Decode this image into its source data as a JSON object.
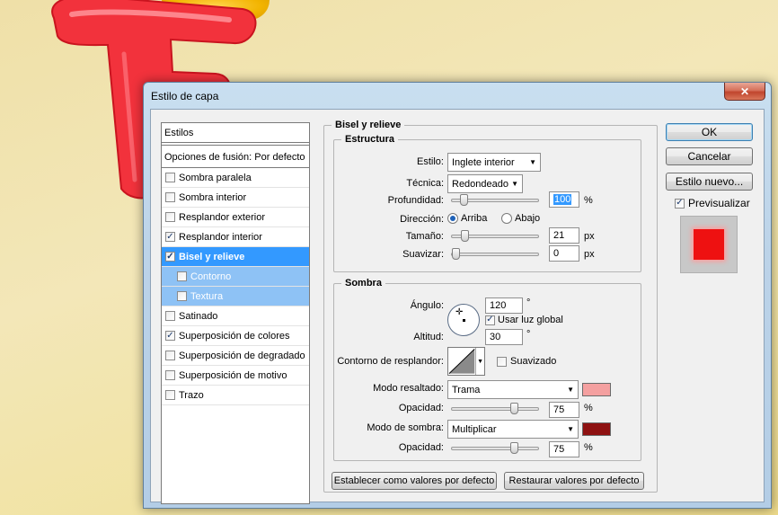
{
  "window": {
    "title": "Estilo de capa",
    "close_label": "✕"
  },
  "styles_panel": {
    "header": "Estilos",
    "blend_options": "Opciones de fusión: Por defecto",
    "items": [
      {
        "label": "Sombra paralela",
        "checked": false,
        "state": "normal"
      },
      {
        "label": "Sombra interior",
        "checked": false,
        "state": "normal"
      },
      {
        "label": "Resplandor exterior",
        "checked": false,
        "state": "normal"
      },
      {
        "label": "Resplandor interior",
        "checked": true,
        "state": "normal"
      },
      {
        "label": "Bisel y relieve",
        "checked": true,
        "state": "selected"
      },
      {
        "label": "Contorno",
        "checked": false,
        "state": "sub"
      },
      {
        "label": "Textura",
        "checked": false,
        "state": "sub"
      },
      {
        "label": "Satinado",
        "checked": false,
        "state": "normal"
      },
      {
        "label": "Superposición de colores",
        "checked": true,
        "state": "normal"
      },
      {
        "label": "Superposición de degradado",
        "checked": false,
        "state": "normal"
      },
      {
        "label": "Superposición de motivo",
        "checked": false,
        "state": "normal"
      },
      {
        "label": "Trazo",
        "checked": false,
        "state": "normal"
      }
    ]
  },
  "bevel": {
    "title": "Bisel y relieve",
    "structure": {
      "title": "Estructura",
      "style_label": "Estilo:",
      "style_value": "Inglete interior",
      "technique_label": "Técnica:",
      "technique_value": "Redondeado",
      "depth_label": "Profundidad:",
      "depth_value": "100",
      "depth_unit": "%",
      "depth_level": 0.1,
      "direction_label": "Dirección:",
      "direction_up": "Arriba",
      "direction_down": "Abajo",
      "direction_selected": "Arriba",
      "size_label": "Tamaño:",
      "size_value": "21",
      "size_unit": "px",
      "size_level": 0.12,
      "soften_label": "Suavizar:",
      "soften_value": "0",
      "soften_unit": "px",
      "soften_level": 0
    },
    "shading": {
      "title": "Sombra",
      "angle_label": "Ángulo:",
      "angle_value": "120",
      "angle_unit": "°",
      "global_light_label": "Usar luz global",
      "global_light_checked": true,
      "altitude_label": "Altitud:",
      "altitude_value": "30",
      "altitude_unit": "°",
      "gloss_contour_label": "Contorno de resplandor:",
      "antialiased_label": "Suavizado",
      "antialiased_checked": false,
      "highlight_mode_label": "Modo resaltado:",
      "highlight_mode_value": "Trama",
      "highlight_color": "#f4a0a0",
      "highlight_opacity_label": "Opacidad:",
      "highlight_opacity_value": "75",
      "highlight_opacity_unit": "%",
      "highlight_opacity_level": 0.75,
      "shadow_mode_label": "Modo de sombra:",
      "shadow_mode_value": "Multiplicar",
      "shadow_color": "#8e1111",
      "shadow_opacity_label": "Opacidad:",
      "shadow_opacity_value": "75",
      "shadow_opacity_unit": "%",
      "shadow_opacity_level": 0.75
    },
    "make_default_label": "Establecer como valores por defecto",
    "reset_default_label": "Restaurar valores por defecto"
  },
  "actions": {
    "ok_label": "OK",
    "cancel_label": "Cancelar",
    "new_style_label": "Estilo nuevo...",
    "preview_label": "Previsualizar",
    "preview_checked": true,
    "preview_color": "#ee1111"
  },
  "colors": {
    "selection": "#3399ff",
    "sub_selection": "#8ec2f5"
  }
}
